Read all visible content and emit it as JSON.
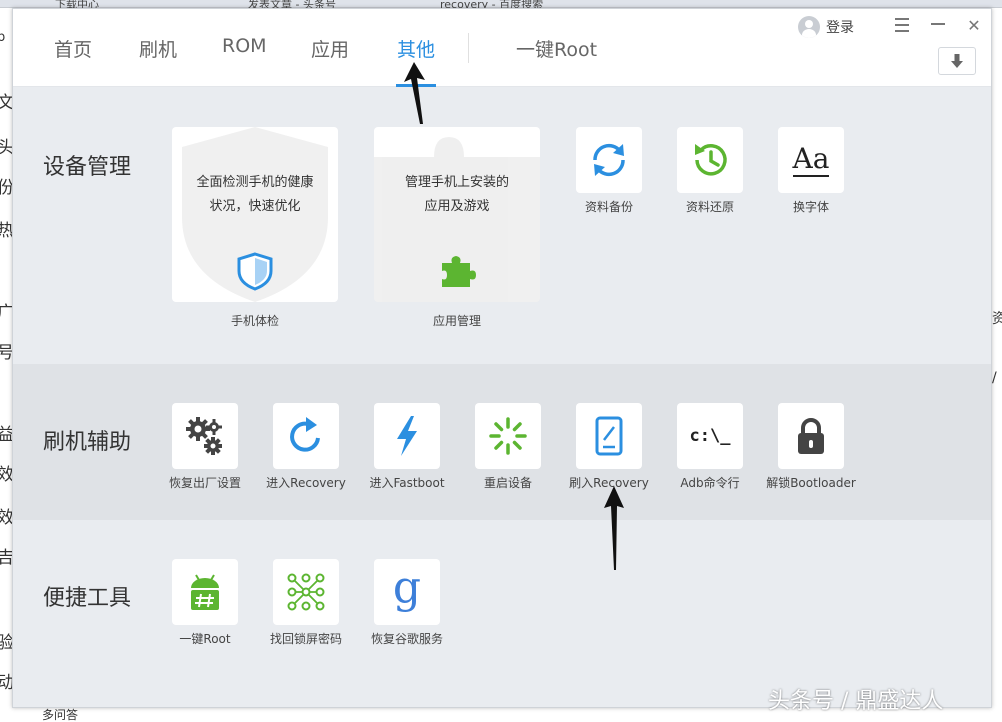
{
  "browser_bg": {
    "tabs": [
      "下载中心",
      "发表文章 - 头条号",
      "recovery - 百度搜索"
    ],
    "left_chars": [
      "p",
      "文",
      "头",
      "份",
      "热",
      "广",
      "号",
      "益",
      "效",
      "效",
      "吉",
      "验",
      "动",
      "多问答"
    ],
    "right_chars": [
      "资",
      "/"
    ]
  },
  "nav": {
    "items": [
      "首页",
      "刷机",
      "ROM",
      "应用",
      "其他"
    ],
    "active": "其他",
    "root_label": "一键Root"
  },
  "header": {
    "login_label": "登录",
    "menu_icon": "menu-icon",
    "minimize_icon": "minimize-icon",
    "close_glyph": "✕",
    "download_icon": "download-arrow-icon"
  },
  "sections": {
    "device": {
      "title": "设备管理",
      "cards": [
        {
          "desc_line1": "全面检测手机的健康",
          "desc_line2": "状况，快速优化",
          "label": "手机体检",
          "icon": "shield-icon"
        },
        {
          "desc_line1": "管理手机上安装的",
          "desc_line2": "应用及游戏",
          "label": "应用管理",
          "icon": "puzzle-icon"
        }
      ],
      "tiles": [
        {
          "label": "资料备份",
          "icon": "sync-icon"
        },
        {
          "label": "资料还原",
          "icon": "history-icon"
        },
        {
          "label": "换字体",
          "icon": "font-icon",
          "glyph": "Aa"
        }
      ]
    },
    "flash": {
      "title": "刷机辅助",
      "tiles": [
        {
          "label": "恢复出厂设置",
          "icon": "gears-icon"
        },
        {
          "label": "进入Recovery",
          "icon": "refresh-icon"
        },
        {
          "label": "进入Fastboot",
          "icon": "lightning-icon"
        },
        {
          "label": "重启设备",
          "icon": "loading-icon"
        },
        {
          "label": "刷入Recovery",
          "icon": "tablet-edit-icon"
        },
        {
          "label": "Adb命令行",
          "icon": "terminal-icon",
          "glyph": "c:\\_"
        },
        {
          "label": "解锁Bootloader",
          "icon": "lock-icon"
        }
      ]
    },
    "tools": {
      "title": "便捷工具",
      "tiles": [
        {
          "label": "一键Root",
          "icon": "android-root-icon"
        },
        {
          "label": "找回锁屏密码",
          "icon": "pattern-lock-icon"
        },
        {
          "label": "恢复谷歌服务",
          "icon": "google-icon",
          "glyph": "g"
        }
      ]
    }
  },
  "watermark": "头条号 / 鼎盛达人",
  "colors": {
    "accent": "#2b8fe0",
    "green": "#5cb531",
    "icon_gray": "#555555",
    "section_bg": "#e9ecf0",
    "section_alt_bg": "#dfe2e6"
  }
}
